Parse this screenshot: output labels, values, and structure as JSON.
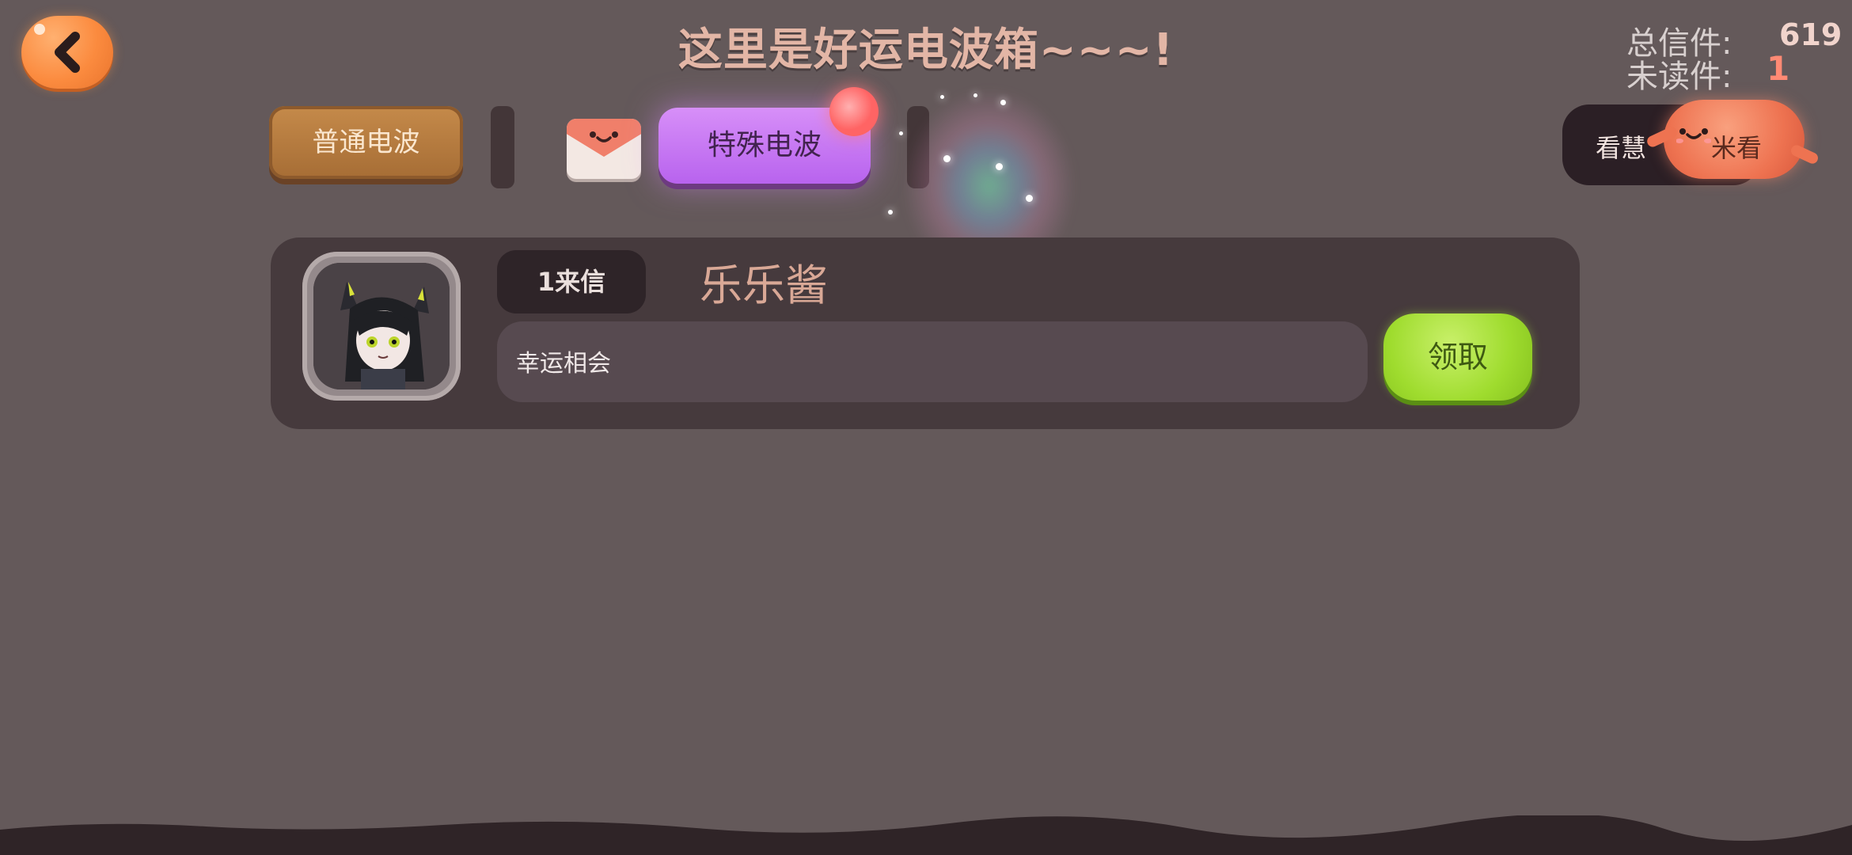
{
  "header": {
    "title": "这里是好运电波箱~~~!",
    "total_label": "总信件:",
    "total_value": "619",
    "unread_label": "未读件:",
    "unread_value": "1"
  },
  "tabs": {
    "normal": "普通电波",
    "special": "特殊电波"
  },
  "watch_button": {
    "left_text": "看慧",
    "right_text": "米看"
  },
  "mail": {
    "letter_count": "1来信",
    "sender": "乐乐酱",
    "message": "幸运相会",
    "claim_label": "领取"
  },
  "colors": {
    "background": "#64595a",
    "accent_orange": "#fb8b3f",
    "special_tab": "#c57af2",
    "claim_green": "#9fdc2e"
  }
}
